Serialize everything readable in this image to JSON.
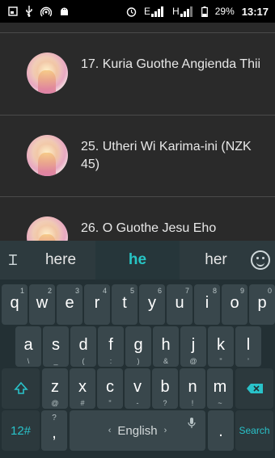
{
  "status_bar": {
    "icons_left": [
      "screen-icon",
      "usb-icon",
      "hotspot-icon",
      "android-icon"
    ],
    "icons_right": [
      "alarm-icon",
      "signal-e-icon",
      "signal-h-icon",
      "battery-icon"
    ],
    "network_e": "E",
    "network_h": "H",
    "battery": "29%",
    "time": "13:17"
  },
  "list": {
    "items": [
      {
        "title": "17. Kuria Guothe Angienda Thii"
      },
      {
        "title": "25. Utheri Wi Karima-ini (NZK 45)"
      },
      {
        "title": "26. O Guothe Jesu Eho"
      }
    ]
  },
  "keyboard": {
    "suggestions": {
      "left": "here",
      "center": "he",
      "right": "her"
    },
    "row1": [
      {
        "key": "q",
        "hint": "1"
      },
      {
        "key": "w",
        "hint": "2"
      },
      {
        "key": "e",
        "hint": "3"
      },
      {
        "key": "r",
        "hint": "4"
      },
      {
        "key": "t",
        "hint": "5"
      },
      {
        "key": "y",
        "hint": "6"
      },
      {
        "key": "u",
        "hint": "7"
      },
      {
        "key": "i",
        "hint": "8"
      },
      {
        "key": "o",
        "hint": "9"
      },
      {
        "key": "p",
        "hint": "0"
      }
    ],
    "row2": [
      {
        "key": "a",
        "sub": "\\"
      },
      {
        "key": "s",
        "sub": "_"
      },
      {
        "key": "d",
        "sub": "("
      },
      {
        "key": "f",
        "sub": ":"
      },
      {
        "key": "g",
        "sub": ")"
      },
      {
        "key": "h",
        "sub": "&"
      },
      {
        "key": "j",
        "sub": "@"
      },
      {
        "key": "k",
        "sub": "\""
      },
      {
        "key": "l",
        "sub": "'"
      }
    ],
    "row3": [
      {
        "key": "z",
        "sub": "@"
      },
      {
        "key": "x",
        "sub": "#"
      },
      {
        "key": "c",
        "sub": "\""
      },
      {
        "key": "v",
        "sub": "-"
      },
      {
        "key": "b",
        "sub": "?"
      },
      {
        "key": "n",
        "sub": "!"
      },
      {
        "key": "m",
        "sub": "~"
      }
    ],
    "symbols_label": "12#",
    "comma_top": "?",
    "comma": ",",
    "space_label": "English",
    "period": ".",
    "search_label": "Search",
    "accent_color": "#29c2c9"
  }
}
